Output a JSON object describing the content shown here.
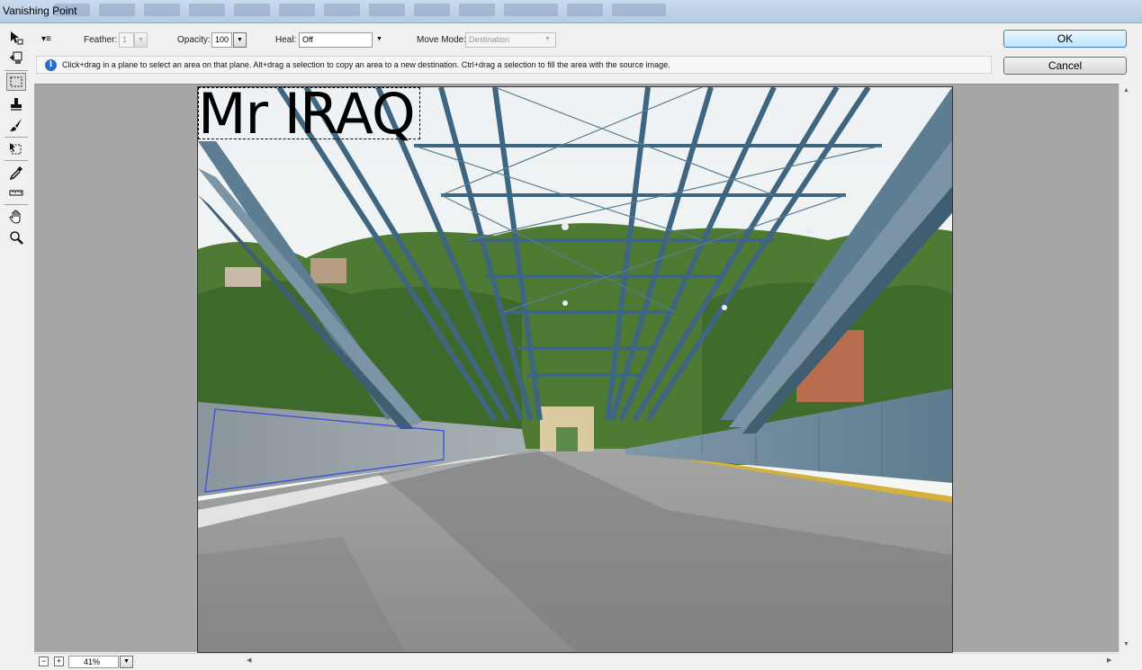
{
  "window": {
    "title": "Vanishing Point"
  },
  "toolbar": {
    "options_menu_glyph": "▾≡",
    "feather_label": "Feather:",
    "feather_value": "1",
    "opacity_label": "Opacity:",
    "opacity_value": "100",
    "heal_label": "Heal:",
    "heal_value": "Off",
    "move_mode_label": "Move Mode:",
    "move_mode_value": "Destination"
  },
  "buttons": {
    "ok": "OK",
    "cancel": "Cancel"
  },
  "info": {
    "icon": "info-icon",
    "text": "Click+drag in a plane to select an area on that plane. Alt+drag a selection to copy an area to a new destination. Ctrl+drag a selection to fill the area with the source image."
  },
  "tools": [
    {
      "name": "edit-plane-tool-icon"
    },
    {
      "name": "create-plane-tool-icon"
    },
    {
      "name": "marquee-tool-icon",
      "active": true
    },
    {
      "name": "stamp-tool-icon"
    },
    {
      "name": "brush-tool-icon"
    },
    {
      "name": "transform-tool-icon"
    },
    {
      "name": "eyedropper-tool-icon"
    },
    {
      "name": "measure-tool-icon"
    },
    {
      "name": "hand-tool-icon"
    },
    {
      "name": "zoom-tool-icon"
    }
  ],
  "canvas": {
    "overlay_text": "Mr IRAQ",
    "plane_grid_color": "#3b4fd8"
  },
  "zoom": {
    "zoom_out": "−",
    "zoom_in": "+",
    "value": "41%"
  }
}
